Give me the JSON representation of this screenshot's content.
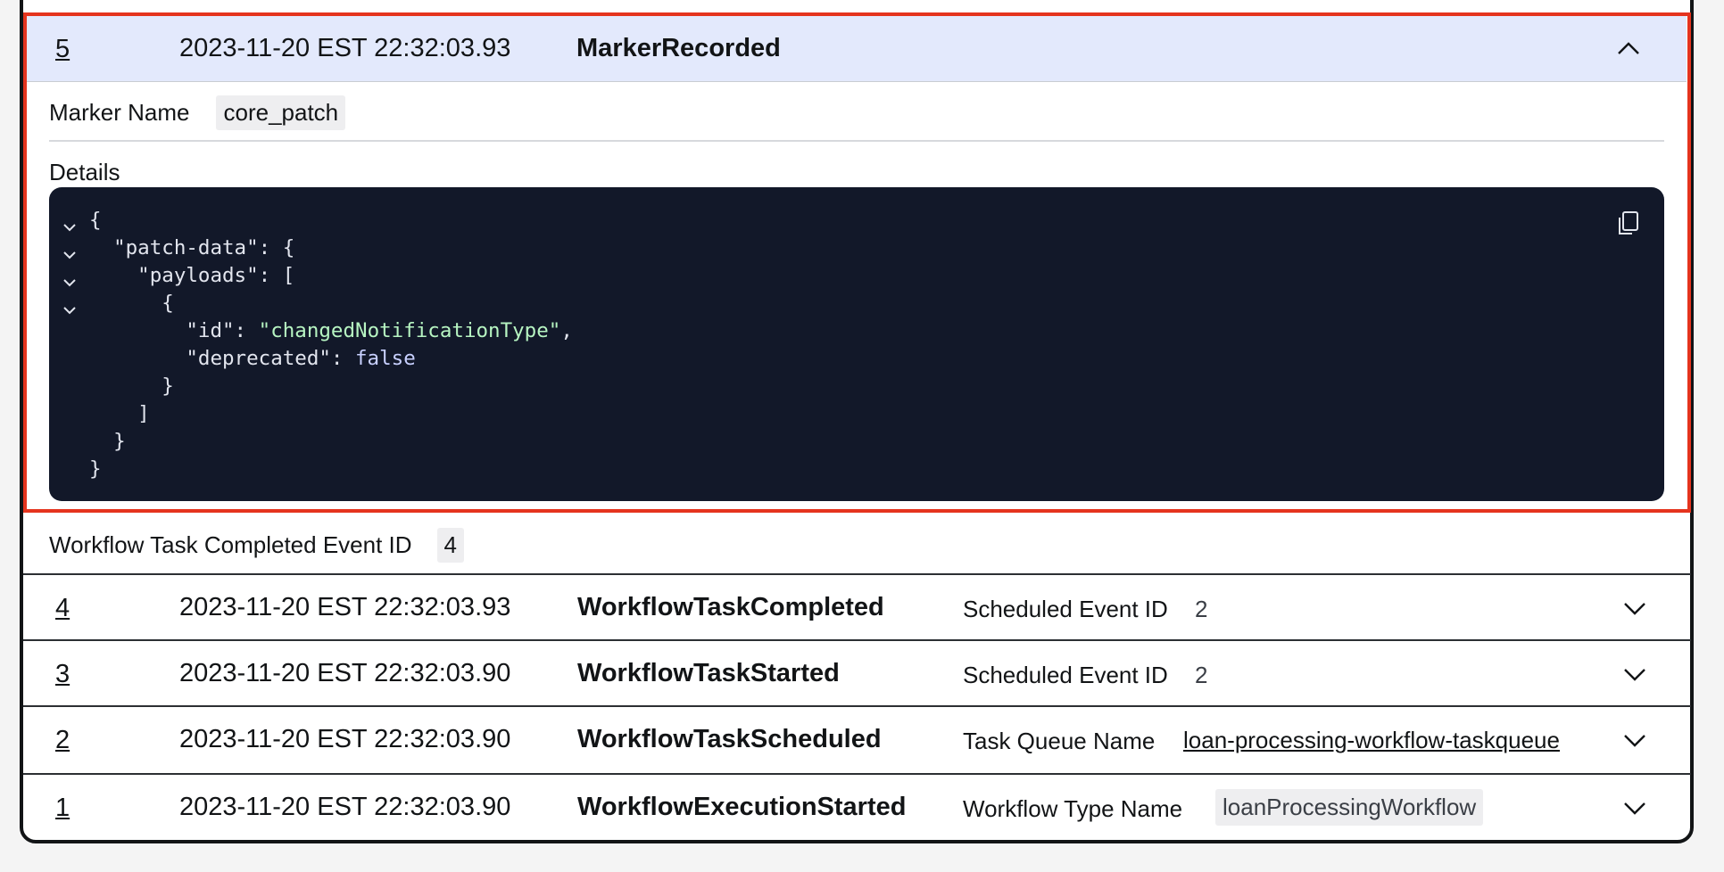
{
  "expanded_event": {
    "id": "5",
    "timestamp": "2023-11-20 EST 22:32:03.93",
    "event_type": "MarkerRecorded",
    "marker_name_label": "Marker Name",
    "marker_name_value": "core_patch",
    "details_label": "Details",
    "code_lines": [
      "{",
      "  \"patch-data\": {",
      "    \"payloads\": [",
      "      {",
      "        \"id\": \"changedNotificationType\",",
      "        \"deprecated\": false",
      "      }",
      "    ]",
      "  }",
      "}"
    ],
    "workflow_task_completed_label": "Workflow Task Completed Event ID",
    "workflow_task_completed_value": "4"
  },
  "events": [
    {
      "id": "4",
      "timestamp": "2023-11-20 EST 22:32:03.93",
      "event_type": "WorkflowTaskCompleted",
      "attr_label": "Scheduled Event ID",
      "attr_value": "2"
    },
    {
      "id": "3",
      "timestamp": "2023-11-20 EST 22:32:03.90",
      "event_type": "WorkflowTaskStarted",
      "attr_label": "Scheduled Event ID",
      "attr_value": "2"
    },
    {
      "id": "2",
      "timestamp": "2023-11-20 EST 22:32:03.90",
      "event_type": "WorkflowTaskScheduled",
      "attr_label": "Task Queue Name",
      "attr_value": "loan-processing-workflow-taskqueue"
    },
    {
      "id": "1",
      "timestamp": "2023-11-20 EST 22:32:03.90",
      "event_type": "WorkflowExecutionStarted",
      "attr_label": "Workflow Type Name",
      "attr_value": "loanProcessingWorkflow"
    }
  ],
  "icons": {
    "collapse": "chevron-up-icon",
    "expand": "chevron-down-icon",
    "fold": "fold-chevron-icon",
    "copy": "copy-icon"
  },
  "colors": {
    "highlight": "#e5341e",
    "header_bg": "#e3e9fc",
    "code_bg": "#121829",
    "string": "#b7f5c2"
  }
}
